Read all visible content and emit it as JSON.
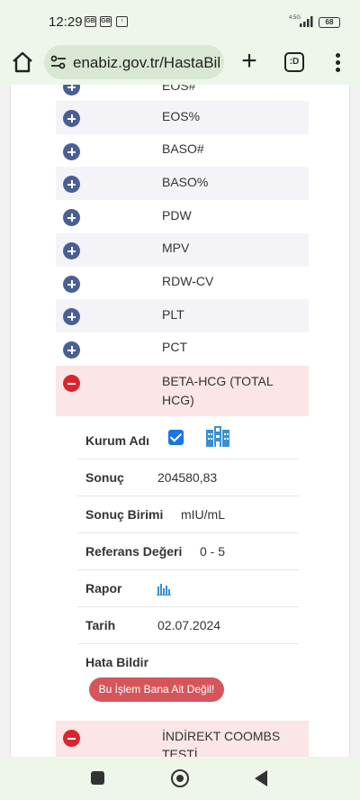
{
  "status_bar": {
    "time": "12:29",
    "icon1": "GB",
    "icon2": "GB",
    "icon3": "↑",
    "network": "4.5G",
    "battery": "68"
  },
  "browser": {
    "url": "enabiz.gov.tr/HastaBil",
    "tabs_label": ":D"
  },
  "tests": [
    {
      "name": "EOS#",
      "state": "collapsed"
    },
    {
      "name": "EOS%",
      "state": "collapsed"
    },
    {
      "name": "BASO#",
      "state": "collapsed"
    },
    {
      "name": "BASO%",
      "state": "collapsed"
    },
    {
      "name": "PDW",
      "state": "collapsed"
    },
    {
      "name": "MPV",
      "state": "collapsed"
    },
    {
      "name": "RDW-CV",
      "state": "collapsed"
    },
    {
      "name": "PLT",
      "state": "collapsed"
    },
    {
      "name": "PCT",
      "state": "collapsed"
    },
    {
      "name_line1": "BETA-HCG (TOTAL",
      "name_line2": "HCG)",
      "state": "expanded"
    },
    {
      "name_line1": "İNDİREKT COOMBS",
      "name_line2": "TESTİ",
      "state": "expanded"
    }
  ],
  "details": {
    "kurum_adi_label": "Kurum Adı",
    "kurum_adi_checked": true,
    "sonuc_label": "Sonuç",
    "sonuc_value": "204580,83",
    "birim_label": "Sonuç Birimi",
    "birim_value": "mIU/mL",
    "referans_label": "Referans Değeri",
    "referans_value": "0 - 5",
    "rapor_label": "Rapor",
    "tarih_label": "Tarih",
    "tarih_value": "02.07.2024",
    "hata_label": "Hata Bildir",
    "hata_button": "Bu İşlem Bana Ait Değil!"
  },
  "colors": {
    "plus_button": "#4a5f94",
    "minus_button": "#d8262e",
    "expanded_row": "#fbe5e7",
    "alt_row": "#f4f4f8",
    "report_button": "#d6555b"
  }
}
